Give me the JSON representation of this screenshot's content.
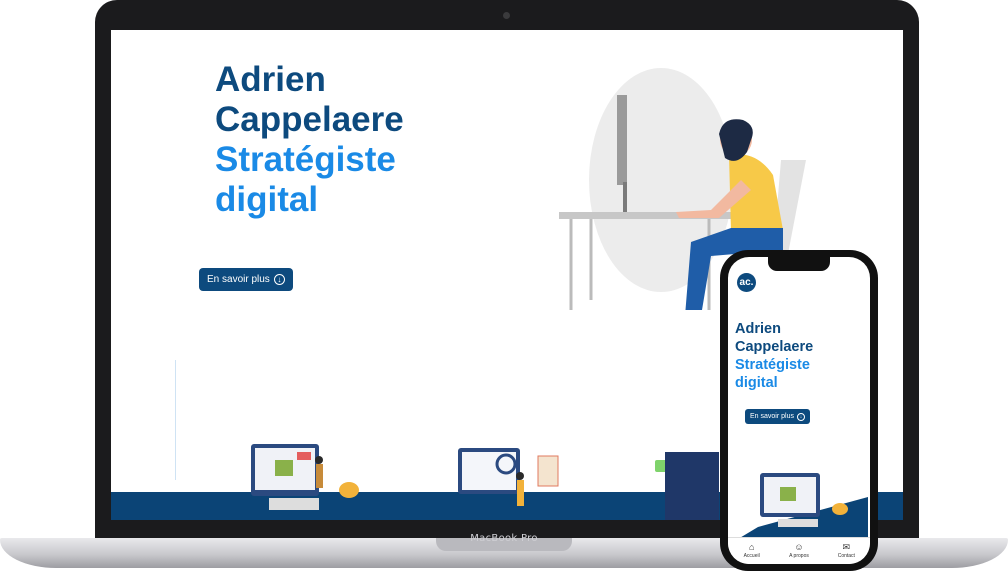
{
  "desktop": {
    "title_line1": "Adrien",
    "title_line2": "Cappelaere",
    "subtitle_line1": "Stratégiste",
    "subtitle_line2": "digital",
    "cta_label": "En savoir plus"
  },
  "laptop_brand": "MacBook Pro",
  "mobile": {
    "logo": "ac.",
    "title_line1": "Adrien",
    "title_line2": "Cappelaere",
    "subtitle_line1": "Stratégiste",
    "subtitle_line2": "digital",
    "cta_label": "En savoir plus",
    "nav": [
      {
        "label": "Accueil",
        "icon": "home-icon"
      },
      {
        "label": "A propos",
        "icon": "user-icon"
      },
      {
        "label": "Contact",
        "icon": "mail-icon"
      }
    ]
  },
  "colors": {
    "brand_dark": "#0d4a7e",
    "brand_light": "#1a8ae6",
    "footer": "#0b4476"
  }
}
